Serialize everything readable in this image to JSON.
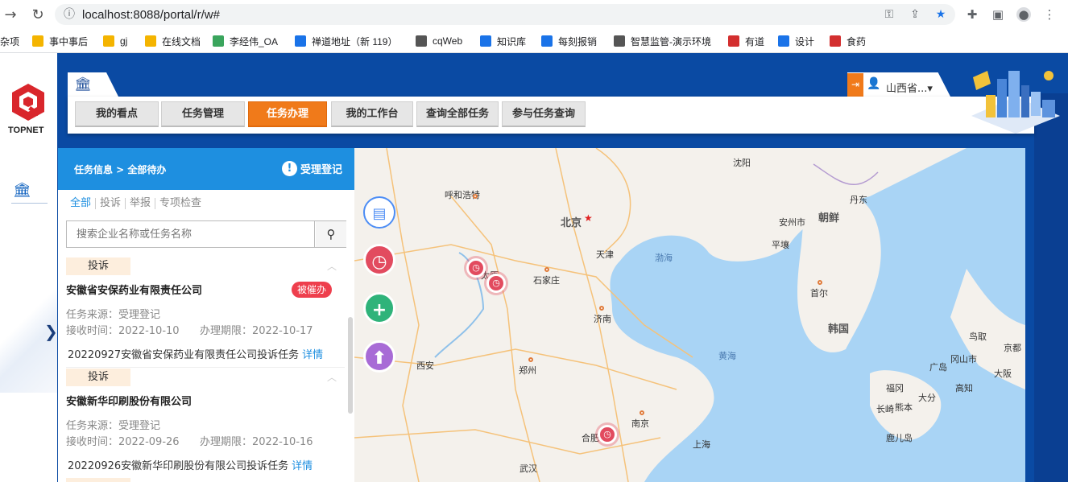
{
  "browser": {
    "url": "localhost:8088/portal/r/w#",
    "bookmarks": [
      {
        "label": "杂项",
        "color": ""
      },
      {
        "label": "事中事后",
        "color": "#f4b400"
      },
      {
        "label": "gj",
        "color": "#f4b400"
      },
      {
        "label": "在线文档",
        "color": "#f4b400"
      },
      {
        "label": "李经伟_OA",
        "color": "#3aa55d"
      },
      {
        "label": "禅道地址（新 119）",
        "color": "#1a73e8"
      },
      {
        "label": "cqWeb",
        "color": "#555555"
      },
      {
        "label": "知识库",
        "color": "#1a73e8"
      },
      {
        "label": "每刻报销",
        "color": "#1a73e8"
      },
      {
        "label": "智慧监管-演示环境",
        "color": "#555555"
      },
      {
        "label": "有道",
        "color": "#d32f2f"
      },
      {
        "label": "设计",
        "color": "#1a73e8"
      },
      {
        "label": "食药",
        "color": "#d32f2f"
      }
    ]
  },
  "app": {
    "logo_text": "TOPNET",
    "user_name": "山西省...▾",
    "nav_tabs": [
      "我的看点",
      "任务管理",
      "任务办理",
      "我的工作台",
      "查询全部任务",
      "参与任务查询"
    ],
    "active_tab": 2
  },
  "panel": {
    "breadcrumb": "任务信息 > 全部待办",
    "register_button": "受理登记",
    "filters": [
      "全部",
      "投诉",
      "举报",
      "专项检查"
    ],
    "search_placeholder": "搜索企业名称或任务名称",
    "cards": [
      {
        "tag": "投诉",
        "company": "安徽省安保药业有限责任公司",
        "badge": "被催办",
        "source": "任务来源：受理登记",
        "received": "接收时间：2022-10-10",
        "deadline": "办理期限：2022-10-17",
        "description": "20220927安徽省安保药业有限责任公司投诉任务",
        "detail_link": "详情"
      },
      {
        "tag": "投诉",
        "company": "安徽新华印刷股份有限公司",
        "badge": "",
        "source": "任务来源：受理登记",
        "received": "接收时间：2022-09-26",
        "deadline": "办理期限：2022-10-16",
        "description": "20220926安徽新华印刷股份有限公司投诉任务",
        "detail_link": "详情"
      }
    ]
  },
  "map": {
    "labels": [
      "沈阳",
      "呼和浩特",
      "北京",
      "丹东",
      "朝鲜",
      "安州市",
      "天津",
      "平壤",
      "渤海",
      "太原",
      "石家庄",
      "首尔",
      "济南",
      "韩国",
      "黄海",
      "西安",
      "郑州",
      "鸟取",
      "京都",
      "冈山市",
      "广岛",
      "大阪",
      "福冈",
      "大分",
      "高知",
      "长崎",
      "熊本",
      "鹿儿岛",
      "南京",
      "合肥",
      "上海",
      "武汉"
    ],
    "fab_colors": {
      "doc": "#4c8df5",
      "clock": "#e24b5f",
      "add": "#2fb37a",
      "route": "#a86bd6"
    }
  }
}
